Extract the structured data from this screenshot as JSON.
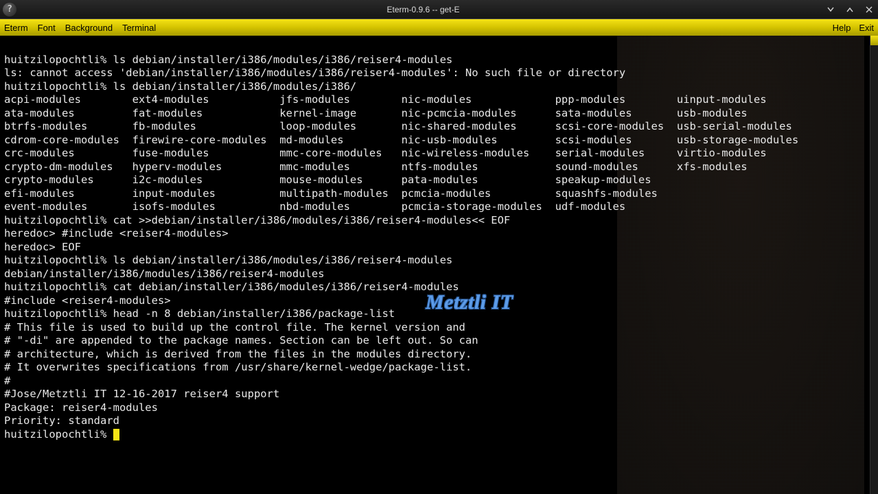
{
  "window": {
    "title": "Eterm-0.9.6 -- get-E",
    "sysicon": "?"
  },
  "menu": {
    "eterm": "Eterm",
    "font": "Font",
    "background": "Background",
    "terminal": "Terminal",
    "help": "Help",
    "exit": "Exit"
  },
  "watermark": "Metztli IT",
  "prompt": "huitzilopochtli%",
  "lines": {
    "l1_cmd": "ls debian/installer/i386/modules/i386/reiser4-modules",
    "l2": "ls: cannot access 'debian/installer/i386/modules/i386/reiser4-modules': No such file or directory",
    "l3_cmd": "ls debian/installer/i386/modules/i386/",
    "columns": {
      "c1": [
        "acpi-modules",
        "ata-modules",
        "btrfs-modules",
        "cdrom-core-modules",
        "crc-modules",
        "crypto-dm-modules",
        "crypto-modules",
        "efi-modules",
        "event-modules"
      ],
      "c2": [
        "ext4-modules",
        "fat-modules",
        "fb-modules",
        "firewire-core-modules",
        "fuse-modules",
        "hyperv-modules",
        "i2c-modules",
        "input-modules",
        "isofs-modules"
      ],
      "c3": [
        "jfs-modules",
        "kernel-image",
        "loop-modules",
        "md-modules",
        "mmc-core-modules",
        "mmc-modules",
        "mouse-modules",
        "multipath-modules",
        "nbd-modules"
      ],
      "c4": [
        "nic-modules",
        "nic-pcmcia-modules",
        "nic-shared-modules",
        "nic-usb-modules",
        "nic-wireless-modules",
        "ntfs-modules",
        "pata-modules",
        "pcmcia-modules",
        "pcmcia-storage-modules"
      ],
      "c5": [
        "ppp-modules",
        "sata-modules",
        "scsi-core-modules",
        "scsi-modules",
        "serial-modules",
        "sound-modules",
        "speakup-modules",
        "squashfs-modules",
        "udf-modules"
      ],
      "c6": [
        "uinput-modules",
        "usb-modules",
        "usb-serial-modules",
        "usb-storage-modules",
        "virtio-modules",
        "xfs-modules",
        "",
        "",
        ""
      ]
    },
    "l_cat_cmd": "cat >>debian/installer/i386/modules/i386/reiser4-modules<< EOF",
    "heredoc1": "heredoc> #include <reiser4-modules>",
    "heredoc2": "heredoc> EOF",
    "l_ls2_cmd": "ls debian/installer/i386/modules/i386/reiser4-modules",
    "l_ls2_out": "debian/installer/i386/modules/i386/reiser4-modules",
    "l_cat2_cmd": "cat debian/installer/i386/modules/i386/reiser4-modules",
    "l_cat2_out": "#include <reiser4-modules>",
    "l_head_cmd": "head -n 8 debian/installer/i386/package-list",
    "head_out": [
      "# This file is used to build up the control file. The kernel version and",
      "# \"-di\" are appended to the package names. Section can be left out. So can",
      "# architecture, which is derived from the files in the modules directory.",
      "# It overwrites specifications from /usr/share/kernel-wedge/package-list.",
      "#",
      "#Jose/Metztli IT 12-16-2017 reiser4 support",
      "Package: reiser4-modules",
      "Priority: standard"
    ]
  }
}
